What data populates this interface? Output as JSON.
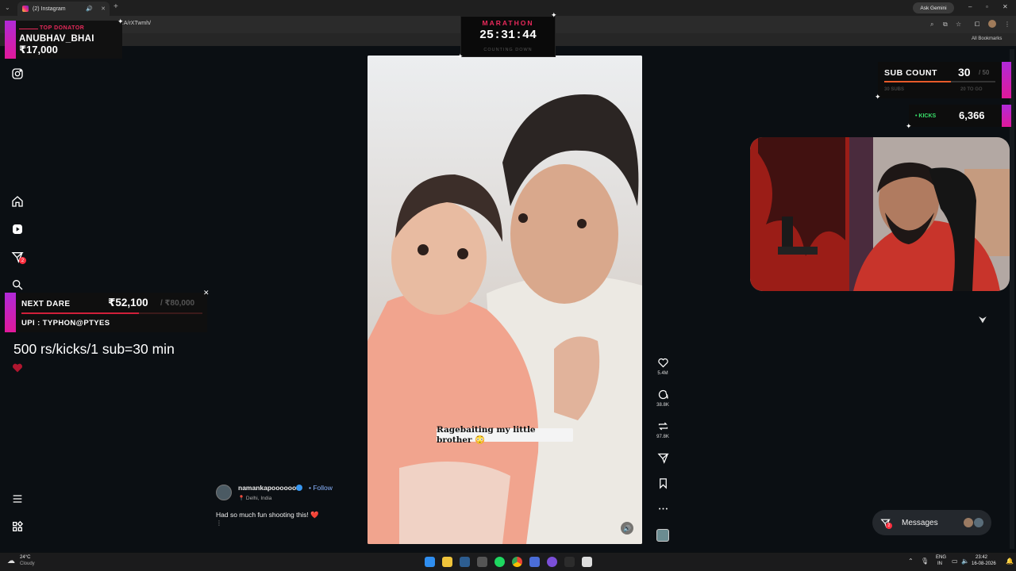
{
  "browser": {
    "tab_title": "(2) Instagram",
    "url": "...A/rXTwmh/",
    "gemini_label": "Ask Gemini",
    "all_bookmarks": "All Bookmarks"
  },
  "overlays": {
    "top_donator": {
      "title": "TOP DONATOR",
      "name": "ANUBHAV_BHAI",
      "amount": "₹17,000"
    },
    "marathon": {
      "title": "MARATHON",
      "time": "25:31:44",
      "subtitle": "COUNTING DOWN"
    },
    "sub_count": {
      "label": "SUB COUNT",
      "value": "30",
      "goal": "/ 50",
      "left_text": "30 SUBS",
      "right_text": "20 TO GO",
      "progress": 0.6
    },
    "kicks": {
      "label": "• KICKS",
      "value": "6,366"
    },
    "next_dare": {
      "label": "NEXT DARE",
      "value": "₹52,100",
      "goal": "/ ₹80,000",
      "upi": "UPI : TYPHON@PTYES",
      "progress": 0.65125
    },
    "rules_text": "500 rs/kicks/1 sub=30 min"
  },
  "reel": {
    "caption_sticker": "Ragebaiting my little brother 😳",
    "author": "namankapoooooor",
    "follow_label": "Follow",
    "location": "Delhi, India",
    "description": "Had so much fun shooting this!",
    "description_emoji": "❤️",
    "more": "⋮",
    "actions": {
      "likes": "5.4M",
      "comments": "38.8K",
      "reposts": "97.8K"
    }
  },
  "messages": {
    "label": "Messages",
    "badge": "2"
  },
  "nav": {
    "notification_badge": "2"
  },
  "taskbar": {
    "weather_temp": "24°C",
    "weather_desc": "Cloudy",
    "lang_line1": "ENG",
    "lang_line2": "IN",
    "time": "23:42",
    "date": "16-08-2026"
  },
  "colors": {
    "accent": "#e8295b",
    "kicks_green": "#39e36b",
    "instagram_blue": "#3897f0"
  }
}
